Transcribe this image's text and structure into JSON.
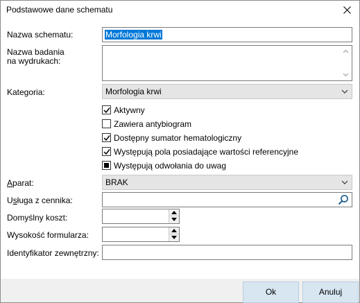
{
  "window": {
    "title": "Podstawowe dane schematu"
  },
  "icons": {
    "close": "close-icon",
    "search": "search-icon",
    "dropdown": "chevron-down-icon"
  },
  "fields": {
    "name_label": "Nazwa schematu:",
    "name_value": "Morfologia krwi",
    "printout_label_line1": "Nazwa badania",
    "printout_label_line2": "na wydrukach:",
    "printout_value": "",
    "category_label": "Kategoria:",
    "category_value": "Morfologia krwi",
    "device_label_underlined": "A",
    "device_label_rest": "parat:",
    "device_value": "BRAK",
    "service_label_pre": "U",
    "service_label_underlined": "s",
    "service_label_rest": "ługa z cennika:",
    "service_value": "",
    "cost_label": "Domyślny koszt:",
    "cost_value": "",
    "height_label": "Wysokość formularza:",
    "height_value": "",
    "external_id_label": "Identyfikator zewnętrzny:",
    "external_id_value": ""
  },
  "checkboxes": [
    {
      "label": "Aktywny",
      "state": "checked"
    },
    {
      "label": "Zawiera antybiogram",
      "state": "unchecked"
    },
    {
      "label": "Dostępny sumator hematologiczny",
      "state": "checked"
    },
    {
      "label": "Występują pola posiadające wartości referencyjne",
      "state": "checked"
    },
    {
      "label": "Występują odwołania do uwag",
      "state": "indeterminate"
    }
  ],
  "buttons": {
    "ok": "Ok",
    "cancel": "Anuluj"
  }
}
